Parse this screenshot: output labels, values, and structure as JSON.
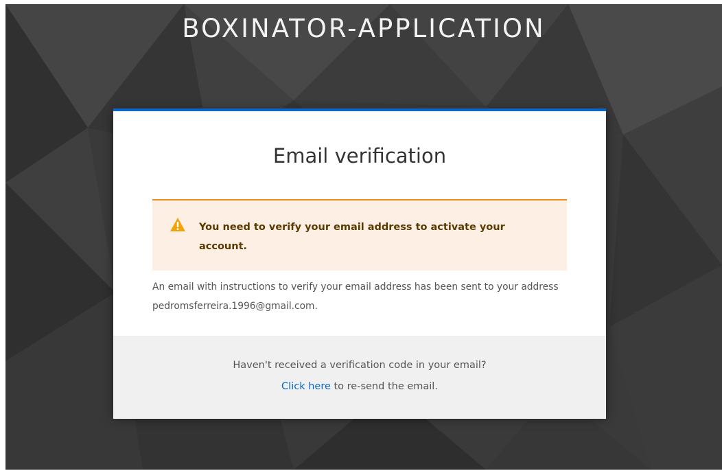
{
  "app": {
    "title": "BOXINATOR-APPLICATION"
  },
  "card": {
    "title": "Email verification",
    "accent_color": "#0a66c8"
  },
  "alert": {
    "icon": "warning-triangle-icon",
    "message": "You need to verify your email address to activate your account.",
    "border_color": "#ec8f1a",
    "background_color": "#fdefe4"
  },
  "info": {
    "message": "An email with instructions to verify your email address has been sent to your address pedromsferreira.1996@gmail.com."
  },
  "footer": {
    "question": "Haven't received a verification code in your email?",
    "link_label": "Click here",
    "link_suffix": " to re-send the email."
  }
}
